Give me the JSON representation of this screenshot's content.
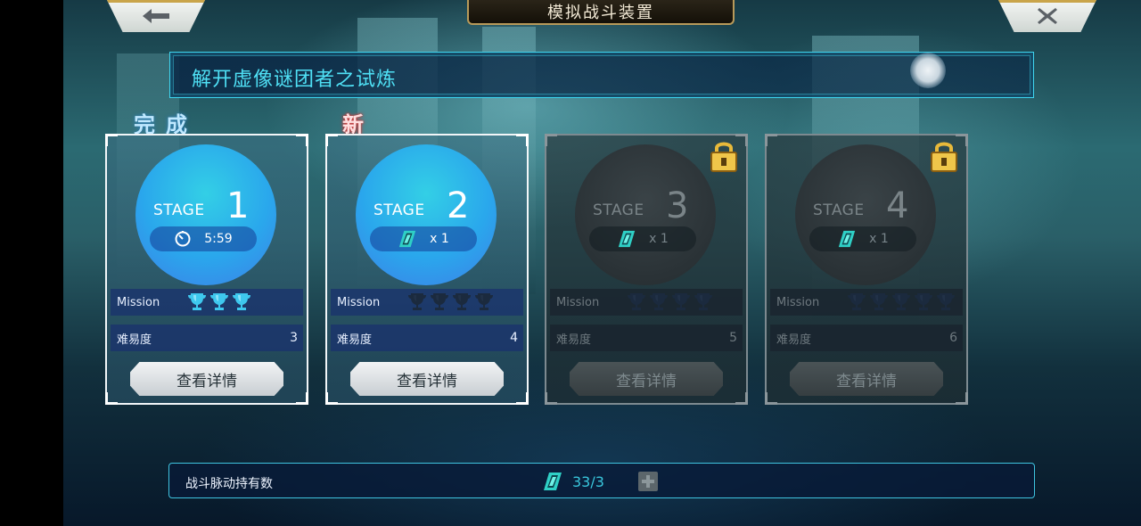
{
  "header": {
    "title": "模拟战斗装置",
    "back_icon": "arrow-left-icon",
    "close_icon": "close-icon"
  },
  "banner": {
    "text": "解开虚像谜团者之试炼"
  },
  "tags": {
    "done": "完成",
    "new": "新"
  },
  "stages": [
    {
      "stage_word": "STAGE",
      "number": "1",
      "pill_icon": "clock-icon",
      "pill_text": "5:59",
      "mission_label": "Mission",
      "trophies_earned": 3,
      "trophies_total": 3,
      "difficulty_label": "难易度",
      "difficulty": "3",
      "button": "查看详情",
      "locked": false
    },
    {
      "stage_word": "STAGE",
      "number": "2",
      "pill_icon": "battle-pulse-icon",
      "pill_text": "x 1",
      "mission_label": "Mission",
      "trophies_earned": 0,
      "trophies_total": 4,
      "difficulty_label": "难易度",
      "difficulty": "4",
      "button": "查看详情",
      "locked": false
    },
    {
      "stage_word": "STAGE",
      "number": "3",
      "pill_icon": "battle-pulse-icon",
      "pill_text": "x 1",
      "mission_label": "Mission",
      "trophies_earned": 0,
      "trophies_total": 4,
      "difficulty_label": "难易度",
      "difficulty": "5",
      "button": "查看详情",
      "locked": true
    },
    {
      "stage_word": "STAGE",
      "number": "4",
      "pill_icon": "battle-pulse-icon",
      "pill_text": "x 1",
      "mission_label": "Mission",
      "trophies_earned": 0,
      "trophies_total": 5,
      "difficulty_label": "难易度",
      "difficulty": "6",
      "button": "查看详情",
      "locked": true
    }
  ],
  "footer": {
    "label": "战斗脉动持有数",
    "count": "33/3",
    "plus_icon": "plus-icon"
  },
  "colors": {
    "accent_cyan": "#3fd6f0",
    "disc_blue": "#2aa7ec",
    "gold": "#c9a44a"
  }
}
